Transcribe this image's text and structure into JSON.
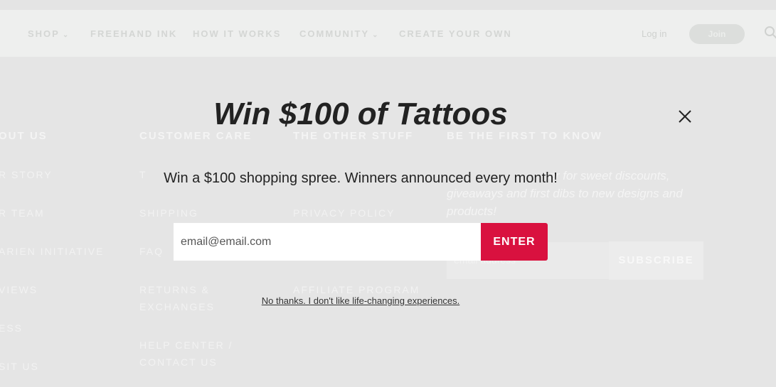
{
  "nav": {
    "items": [
      {
        "label": "SHOP",
        "has_dropdown": true
      },
      {
        "label": "FREEHAND INK",
        "has_dropdown": false
      },
      {
        "label": "HOW IT WORKS",
        "has_dropdown": false
      },
      {
        "label": "COMMUNITY",
        "has_dropdown": true
      },
      {
        "label": "CREATE YOUR OWN",
        "has_dropdown": false
      }
    ],
    "login": "Log in",
    "join": "Join",
    "search_icon": "search-icon"
  },
  "footer": {
    "columns": [
      {
        "heading": "OUT US",
        "links": [
          "R STORY",
          "R TEAM",
          "ARIEN INITIATIVE",
          "VIEWS",
          "ESS",
          "SIT US"
        ]
      },
      {
        "heading": "CUSTOMER CARE",
        "links": [
          "T",
          "SHIPPING",
          "FAQ",
          "RETURNS &",
          "EXCHANGES",
          "HELP CENTER /",
          "CONTACT US"
        ]
      },
      {
        "heading": "THE OTHER STUFF",
        "links": [
          "PRIVACY POLICY",
          "AFFILIATE PROGRAM"
        ]
      },
      {
        "heading": "BE THE FIRST TO KNOW",
        "links": []
      }
    ],
    "newsletter_line1": "tter for sweet discounts,",
    "newsletter_line2": "giveaways and first dibs to new designs and",
    "newsletter_line3": "products!",
    "subscribe": "SUBSCRIBE",
    "email_placeholder": "email address"
  },
  "popup": {
    "title": "Win $100 of Tattoos",
    "subtitle": "Win a $100 shopping spree. Winners announced every month!",
    "email_placeholder": "email@email.com",
    "enter": "ENTER",
    "decline": "No thanks. I don't like life-changing experiences.",
    "close_icon": "close-icon",
    "accent_color": "#d9113f"
  }
}
